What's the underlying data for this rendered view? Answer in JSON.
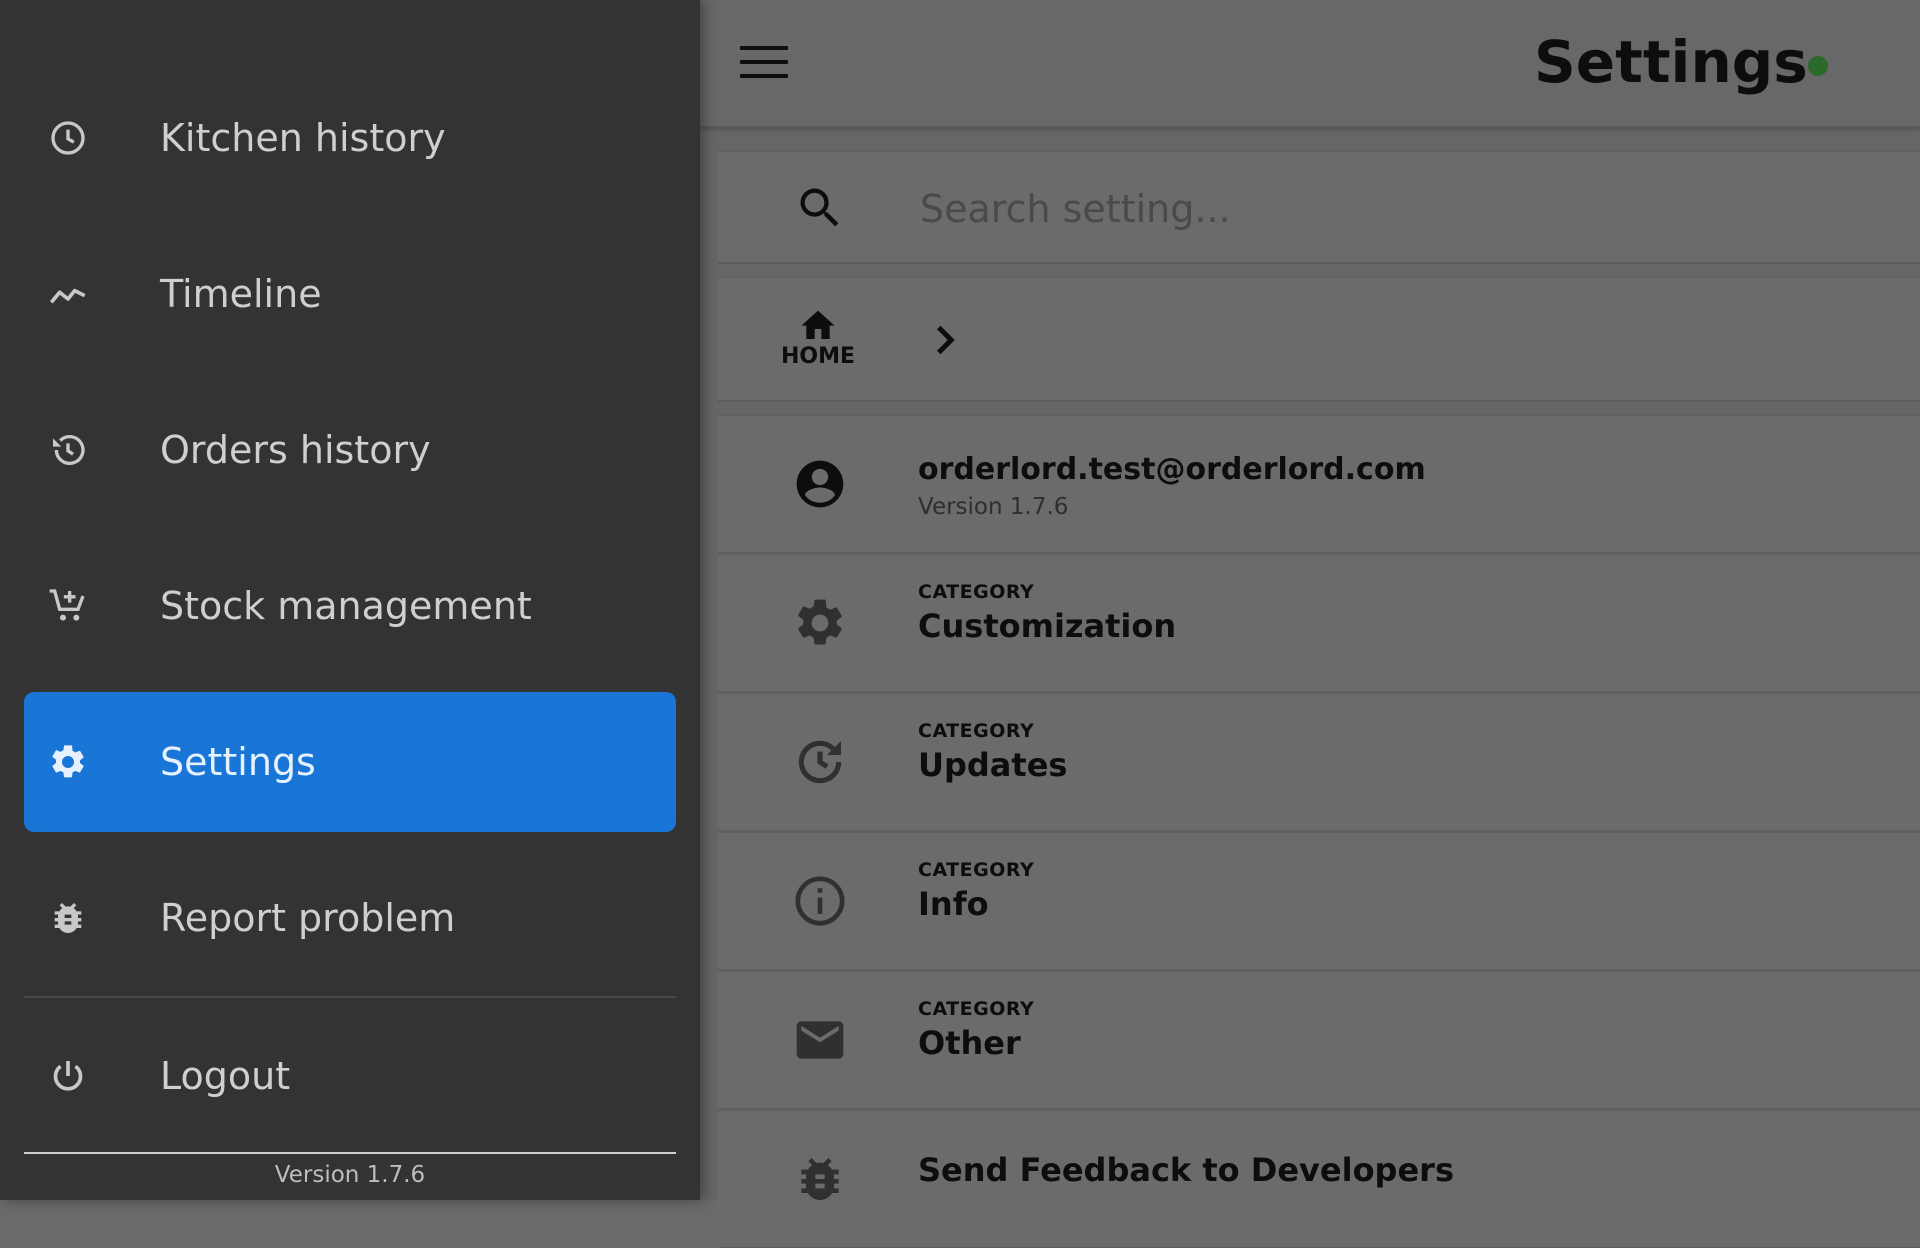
{
  "header": {
    "title": "Settings",
    "status_color": "#2a6a2a"
  },
  "search": {
    "placeholder": "Search setting..."
  },
  "breadcrumb": {
    "home_label": "HOME"
  },
  "account": {
    "email": "orderlord.test@orderlord.com",
    "version": "Version 1.7.6"
  },
  "categories": [
    {
      "sub": "CATEGORY",
      "label": "Customization",
      "icon": "gear-icon"
    },
    {
      "sub": "CATEGORY",
      "label": "Updates",
      "icon": "update-clock-icon"
    },
    {
      "sub": "CATEGORY",
      "label": "Info",
      "icon": "info-icon"
    },
    {
      "sub": "CATEGORY",
      "label": "Other",
      "icon": "mail-icon"
    }
  ],
  "feedback": {
    "label": "Send Feedback to Developers",
    "icon": "bug-icon"
  },
  "drawer": {
    "items": [
      {
        "label": "Kitchen history",
        "icon": "clock-icon"
      },
      {
        "label": "Timeline",
        "icon": "timeline-icon"
      },
      {
        "label": "Orders history",
        "icon": "history-icon"
      },
      {
        "label": "Stock management",
        "icon": "cart-add-icon"
      },
      {
        "label": "Settings",
        "icon": "gear-icon",
        "active": true
      },
      {
        "label": "Report problem",
        "icon": "bug-icon"
      },
      {
        "label": "Logout",
        "icon": "power-icon"
      }
    ],
    "version": "Version 1.7.6",
    "active_color": "#1976d6"
  }
}
